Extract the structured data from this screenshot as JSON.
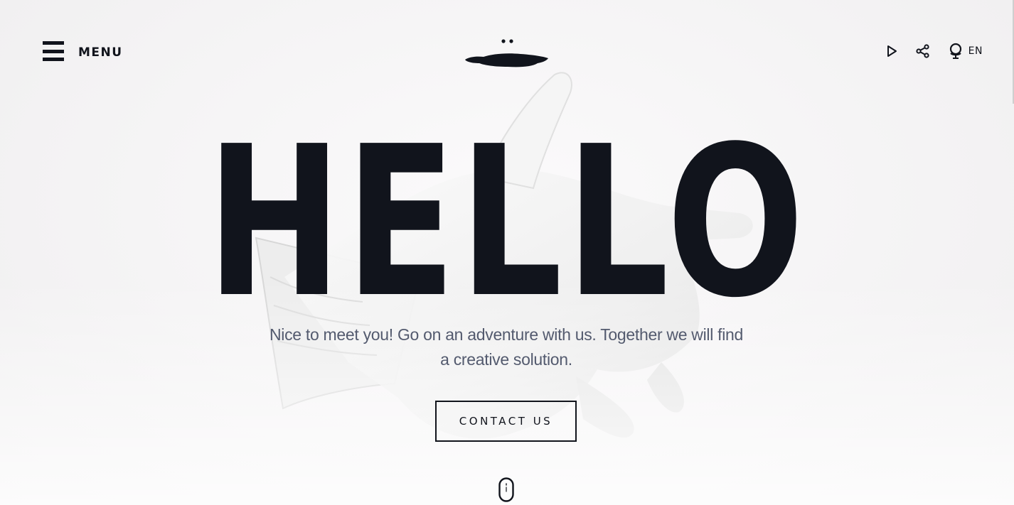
{
  "header": {
    "menu_label": "MENU",
    "language_label": "EN"
  },
  "hero": {
    "headline": "HELLO",
    "subtitle": "Nice to meet you! Go on an adventure with us. Together we will find a creative solution.",
    "cta_label": "CONTACT US"
  },
  "icons": {
    "menu": "hamburger-icon",
    "logo": "ink-face-logo",
    "play": "play-icon",
    "share": "share-icon",
    "language": "globe-icon",
    "scroll": "mouse-scroll-icon"
  },
  "colors": {
    "text": "#11141c",
    "subtitle": "#535a6e",
    "background": "#f6f5f6"
  }
}
